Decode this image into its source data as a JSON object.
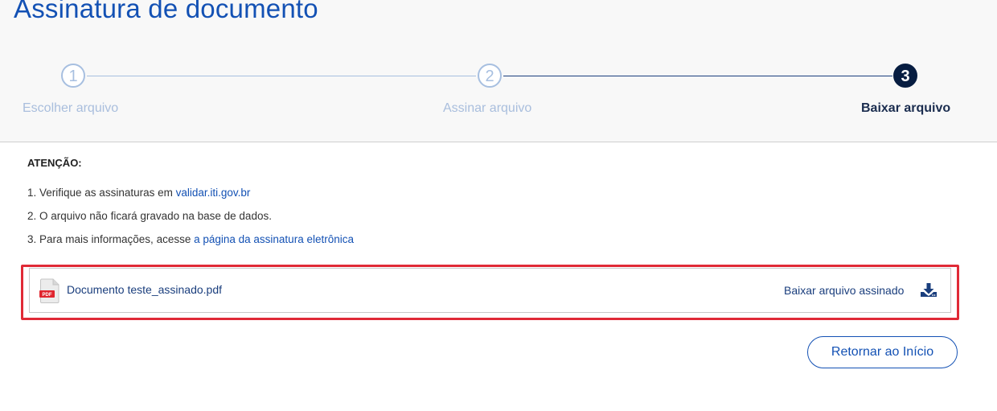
{
  "page": {
    "title": "Assinatura de documento"
  },
  "steps": [
    {
      "number": "1",
      "label": "Escolher arquivo",
      "state": "done"
    },
    {
      "number": "2",
      "label": "Assinar arquivo",
      "state": "done"
    },
    {
      "number": "3",
      "label": "Baixar arquivo",
      "state": "active"
    }
  ],
  "attention": {
    "heading": "ATENÇÃO:",
    "items": [
      {
        "prefix": "1. Verifique as assinaturas em ",
        "link": "validar.iti.gov.br"
      },
      {
        "prefix": "2. O arquivo não ficará gravado na base de dados.",
        "link": ""
      },
      {
        "prefix": "3. Para mais informações, acesse ",
        "link": "a página da assinatura eletrônica"
      }
    ]
  },
  "file": {
    "icon": "pdf-file-icon",
    "icon_text": "PDF",
    "name": "Documento teste_assinado.pdf",
    "download_label": "Baixar arquivo assinado",
    "download_icon": "download-icon"
  },
  "actions": {
    "return_label": "Retornar ao Início"
  },
  "colors": {
    "primary": "#1351b4",
    "dark": "#071d41",
    "step_done": "#a7bfe0",
    "highlight": "#e02a36"
  }
}
